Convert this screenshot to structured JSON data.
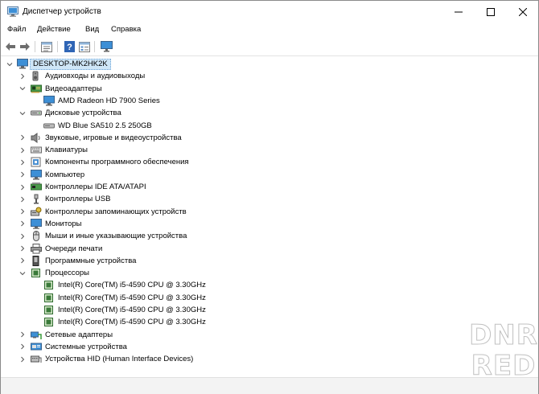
{
  "window": {
    "title": "Диспетчер устройств"
  },
  "menu": [
    "Файл",
    "Действие",
    "Вид",
    "Справка"
  ],
  "tree": {
    "root": "DESKTOP-MK2HK2K",
    "items": [
      {
        "label": "Аудиовходы и аудиовыходы",
        "icon": "speaker-icon",
        "expanded": false
      },
      {
        "label": "Видеоадаптеры",
        "icon": "display-adapter-icon",
        "expanded": true,
        "children": [
          "AMD Radeon HD 7900 Series"
        ]
      },
      {
        "label": "Дисковые устройства",
        "icon": "disk-drive-icon",
        "expanded": true,
        "children": [
          "WD Blue SA510 2.5 250GB"
        ]
      },
      {
        "label": "Звуковые, игровые и видеоустройства",
        "icon": "sound-icon",
        "expanded": false
      },
      {
        "label": "Клавиатуры",
        "icon": "keyboard-icon",
        "expanded": false
      },
      {
        "label": "Компоненты программного обеспечения",
        "icon": "software-component-icon",
        "expanded": false
      },
      {
        "label": "Компьютер",
        "icon": "computer-icon",
        "expanded": false
      },
      {
        "label": "Контроллеры IDE ATA/ATAPI",
        "icon": "ide-controller-icon",
        "expanded": false
      },
      {
        "label": "Контроллеры USB",
        "icon": "usb-icon",
        "expanded": false
      },
      {
        "label": "Контроллеры запоминающих устройств",
        "icon": "storage-controller-icon",
        "expanded": false
      },
      {
        "label": "Мониторы",
        "icon": "monitor-icon",
        "expanded": false
      },
      {
        "label": "Мыши и иные указывающие устройства",
        "icon": "mouse-icon",
        "expanded": false
      },
      {
        "label": "Очереди печати",
        "icon": "printer-icon",
        "expanded": false
      },
      {
        "label": "Программные устройства",
        "icon": "software-device-icon",
        "expanded": false
      },
      {
        "label": "Процессоры",
        "icon": "processor-icon",
        "expanded": true,
        "children": [
          "Intel(R) Core(TM) i5-4590 CPU @ 3.30GHz",
          "Intel(R) Core(TM) i5-4590 CPU @ 3.30GHz",
          "Intel(R) Core(TM) i5-4590 CPU @ 3.30GHz",
          "Intel(R) Core(TM) i5-4590 CPU @ 3.30GHz"
        ]
      },
      {
        "label": "Сетевые адаптеры",
        "icon": "network-adapter-icon",
        "expanded": false
      },
      {
        "label": "Системные устройства",
        "icon": "system-devices-icon",
        "expanded": false
      },
      {
        "label": "Устройства HID (Human Interface Devices)",
        "icon": "hid-icon",
        "expanded": false
      }
    ]
  },
  "watermark": {
    "line1": "DNR",
    "line2": "RED"
  }
}
